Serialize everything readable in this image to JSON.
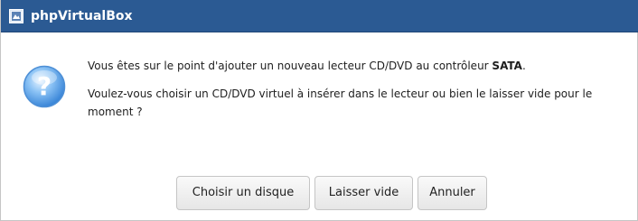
{
  "window": {
    "title": "phpVirtualBox",
    "title_icon": "phpvirtualbox-app-icon",
    "titlebar_color": "#2b5a93"
  },
  "dialog": {
    "icon": "question-icon",
    "message_line1_prefix": "Vous êtes sur le point d'ajouter un nouveau lecteur CD/DVD au contrôleur ",
    "message_line1_controller": "SATA",
    "message_line1_suffix": ".",
    "message_line2": "Voulez-vous choisir un CD/DVD virtuel à insérer dans le lecteur ou bien le laisser vide pour le moment ?"
  },
  "buttons": {
    "choose_disk": "Choisir un disque",
    "leave_empty": "Laisser vide",
    "cancel": "Annuler"
  }
}
